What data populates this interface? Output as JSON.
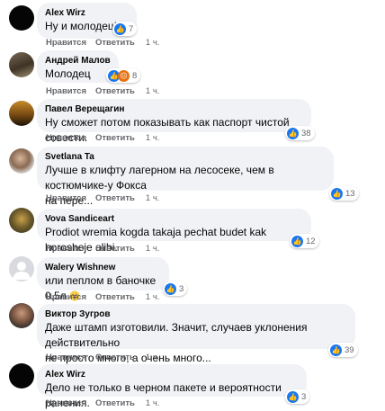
{
  "colors": {
    "bubble": "#f0f2f5",
    "meta": "#65676b",
    "like_blue": "#1877f2",
    "angry": "#e9710f"
  },
  "actions": {
    "like": "Нравится",
    "reply": "Ответить"
  },
  "comments": [
    {
      "author": "Alex Wirz",
      "lines": [
        "Ну и молодец!"
      ],
      "time": "1 ч.",
      "reactions": [
        "like"
      ],
      "count": "7",
      "avatar": "black-circle"
    },
    {
      "author": "Андрей Малов",
      "lines": [
        "Молодец"
      ],
      "time": "1 ч.",
      "reactions": [
        "like",
        "angry"
      ],
      "count": "8",
      "avatar": "photo"
    },
    {
      "author": "Павел Верещагин",
      "lines": [
        "Ну сможет потом показывать как паспорт чистой совести."
      ],
      "time": "1 ч.",
      "reactions": [
        "like"
      ],
      "count": "38",
      "avatar": "sunset-photo"
    },
    {
      "author": "Svetlana Ta",
      "lines": [
        "Лучше в клифту лагерном на лесосеке, чем в костюмчике-у Фокса",
        "на пере..."
      ],
      "time": "1 ч.",
      "reactions": [
        "like"
      ],
      "count": "13",
      "avatar": "photo"
    },
    {
      "author": "Vova Sandiceart",
      "lines": [
        "Prodiot wremia kogda takaja pechat budet kak horosheje alibi."
      ],
      "time": "1 ч.",
      "reactions": [
        "like"
      ],
      "count": "12",
      "avatar": "photo"
    },
    {
      "author": "Walery Wishnew",
      "lines": [
        "или пеплом в баночке 0.5л"
      ],
      "time": "1 ч.",
      "reactions": [
        "like"
      ],
      "count": "3",
      "avatar": "default-silhouette",
      "emoji": "grinning-face"
    },
    {
      "author": "Виктор Зугров",
      "lines": [
        "Даже штамп изготовили. Значит, случаев уклонения действительно",
        "не просто много, а очень много..."
      ],
      "time": "1 ч.",
      "reactions": [
        "like"
      ],
      "count": "39",
      "avatar": "portrait"
    },
    {
      "author": "Alex Wirz",
      "lines": [
        "Дело не только в черном пакете и вероятности ранения."
      ],
      "time": "1 ч.",
      "reactions": [
        "like"
      ],
      "count": "3",
      "avatar": "black-circle"
    }
  ]
}
